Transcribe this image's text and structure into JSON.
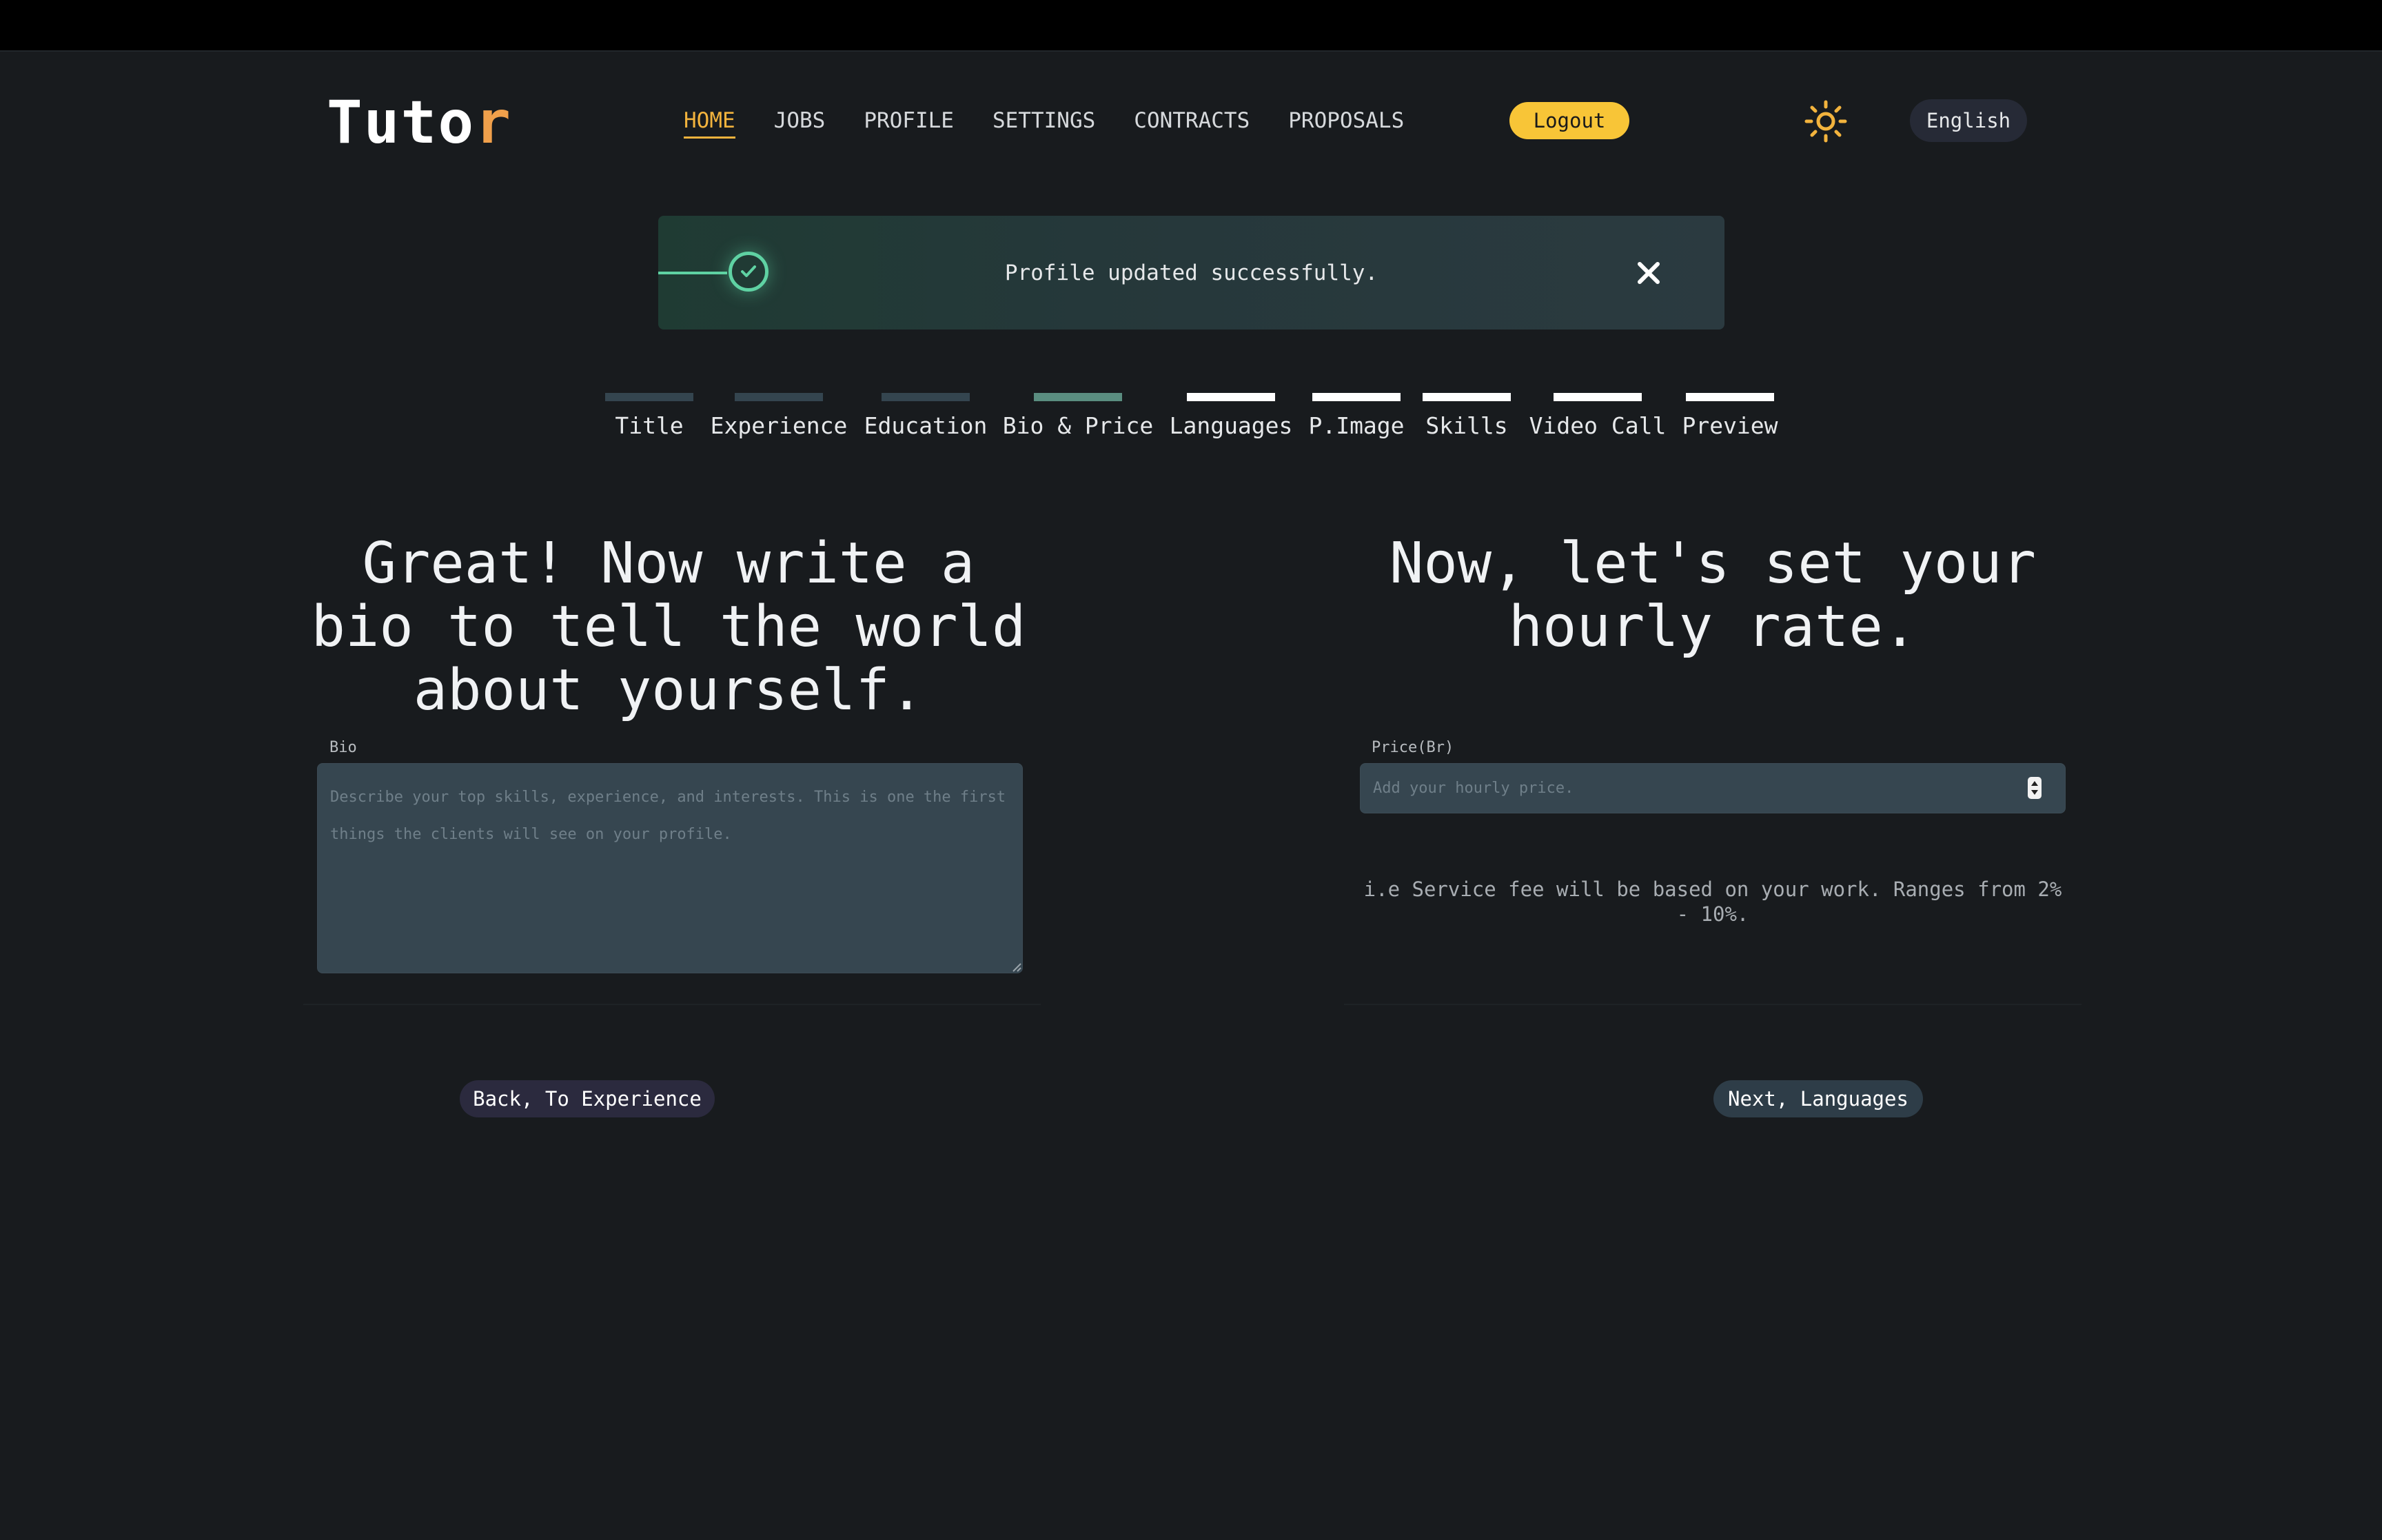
{
  "header": {
    "logo_main": "Tuto",
    "logo_accent": "r",
    "nav": [
      "HOME",
      "JOBS",
      "PROFILE",
      "SETTINGS",
      "CONTRACTS",
      "PROPOSALS"
    ],
    "active_nav": "HOME",
    "logout_label": "Logout",
    "theme_icon": "sun-icon",
    "language_label": "English"
  },
  "toast": {
    "message": "Profile updated successfully.",
    "status": "success",
    "icon": "check-circle-icon",
    "close_icon": "close-icon"
  },
  "steps": {
    "items": [
      "Title",
      "Experience",
      "Education",
      "Bio & Price",
      "Languages",
      "P.Image",
      "Skills",
      "Video Call",
      "Preview"
    ],
    "current": "Bio & Price",
    "completed": [
      "Title",
      "Experience",
      "Education"
    ]
  },
  "bio_section": {
    "heading": "Great! Now write a bio to tell the world about yourself.",
    "label": "Bio",
    "placeholder": "Describe your top skills, experience, and interests. This is one the first things the clients will see on your profile.",
    "value": ""
  },
  "price_section": {
    "heading": "Now, let's set your hourly rate.",
    "label": "Price(Br)",
    "placeholder": "Add your hourly price.",
    "value": "",
    "note": "i.e Service fee will be based on your work. Ranges from 2% - 10%."
  },
  "actions": {
    "back_label": "Back, To Experience",
    "next_label": "Next, Languages"
  },
  "colors": {
    "background": "#181b1e",
    "accent": "#f2b33d",
    "logout_bg": "#f8c537",
    "success": "#5fd2a3",
    "step_done": "#34454f",
    "step_current": "#5a8d80",
    "step_pending": "#ffffff"
  }
}
